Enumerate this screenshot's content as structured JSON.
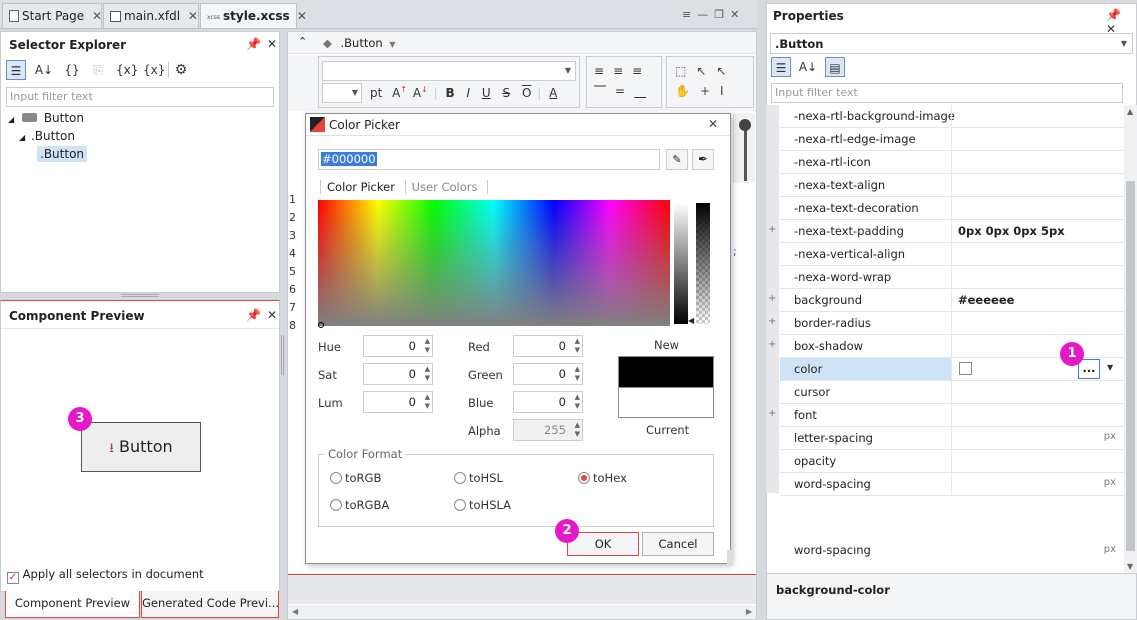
{
  "tabs": [
    {
      "label": "Start Page",
      "icon": "page-icon"
    },
    {
      "label": "main.xfdl",
      "icon": "form-icon"
    },
    {
      "label": "style.xcss",
      "icon": "xcss-icon",
      "active": true
    }
  ],
  "selector_explorer": {
    "title": "Selector Explorer",
    "filter_placeholder": "Input filter text",
    "tree": [
      {
        "label": "Button",
        "level": 0
      },
      {
        "label": ".Button",
        "level": 1
      },
      {
        "label": ".Button",
        "level": 2,
        "selected": true
      }
    ]
  },
  "component_preview": {
    "title": "Component Preview",
    "button_label": "Button",
    "apply_all_label": "Apply all selectors in document",
    "apply_all_checked": true,
    "bottom_tabs": [
      "Component Preview",
      "Generated Code Previ..."
    ]
  },
  "editor": {
    "breadcrumb": ".Button",
    "font_size_unit": "pt",
    "line_numbers": [
      "1",
      "2",
      "3",
      "4",
      "5",
      "6",
      "7",
      "8"
    ]
  },
  "color_picker": {
    "title": "Color Picker",
    "hex_value": "#000000",
    "tabs": [
      "Color Picker",
      "User Colors"
    ],
    "hue_label": "Hue",
    "hue": "0",
    "sat_label": "Sat",
    "sat": "0",
    "lum_label": "Lum",
    "lum": "0",
    "red_label": "Red",
    "red": "0",
    "green_label": "Green",
    "green": "0",
    "blue_label": "Blue",
    "blue": "0",
    "alpha_label": "Alpha",
    "alpha": "255",
    "new_label": "New",
    "current_label": "Current",
    "new_color": "#000000",
    "current_color": "#ffffff",
    "format_title": "Color Format",
    "formats": [
      "toRGB",
      "toHSL",
      "toHex",
      "toRGBA",
      "toHSLA"
    ],
    "selected_format": "toHex",
    "ok_label": "OK",
    "cancel_label": "Cancel"
  },
  "properties": {
    "title": "Properties",
    "selector": ".Button",
    "filter_placeholder": "Input filter text",
    "rows": [
      {
        "name": "-nexa-rtl-background-image",
        "value": "",
        "unit": "",
        "expandable": false
      },
      {
        "name": "-nexa-rtl-edge-image",
        "value": "",
        "unit": "",
        "expandable": false
      },
      {
        "name": "-nexa-rtl-icon",
        "value": "",
        "unit": "",
        "expandable": false
      },
      {
        "name": "-nexa-text-align",
        "value": "",
        "unit": "",
        "expandable": false
      },
      {
        "name": "-nexa-text-decoration",
        "value": "",
        "unit": "",
        "expandable": false
      },
      {
        "name": "-nexa-text-padding",
        "value": "0px 0px 0px 5px",
        "unit": "",
        "expandable": true
      },
      {
        "name": "-nexa-vertical-align",
        "value": "",
        "unit": "",
        "expandable": false
      },
      {
        "name": "-nexa-word-wrap",
        "value": "",
        "unit": "",
        "expandable": false
      },
      {
        "name": "background",
        "value": "#eeeeee",
        "unit": "",
        "expandable": true
      },
      {
        "name": "border-radius",
        "value": "",
        "unit": "",
        "expandable": true
      },
      {
        "name": "box-shadow",
        "value": "",
        "unit": "",
        "expandable": true
      },
      {
        "name": "color",
        "value": "",
        "unit": "",
        "expandable": false,
        "selected": true
      },
      {
        "name": "cursor",
        "value": "",
        "unit": "",
        "expandable": false
      },
      {
        "name": "font",
        "value": "",
        "unit": "",
        "expandable": true
      },
      {
        "name": "letter-spacing",
        "value": "",
        "unit": "px",
        "expandable": false
      },
      {
        "name": "opacity",
        "value": "",
        "unit": "",
        "expandable": false
      },
      {
        "name": "word-spacing",
        "value": "",
        "unit": "px",
        "expandable": false
      }
    ],
    "ghost_row": {
      "name": "word-spacing",
      "unit": "px"
    },
    "ellipsis_label": "...",
    "description": "background-color"
  },
  "badges": [
    "1",
    "2",
    "3"
  ],
  "colors": {
    "accent": "#e619c8",
    "selection": "#cfe3f7",
    "radio_on": "#e0463c"
  }
}
